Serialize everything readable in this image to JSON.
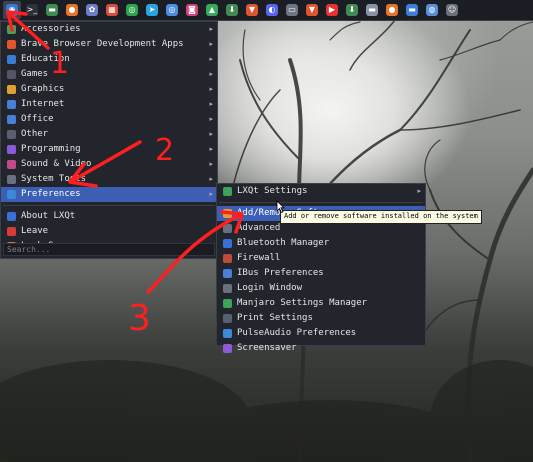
{
  "taskbar": {
    "icons": [
      {
        "name": "app-menu-icon",
        "color": "#3a78d8",
        "glyph": "◉"
      },
      {
        "name": "terminal-icon",
        "color": "#2e3138",
        "glyph": ">_"
      },
      {
        "name": "files-icon",
        "color": "#3f8b52",
        "glyph": "▬"
      },
      {
        "name": "firefox-icon",
        "color": "#e8742a",
        "glyph": "●"
      },
      {
        "name": "settings-icon",
        "color": "#6b7cc8",
        "glyph": "✿"
      },
      {
        "name": "grid-icon",
        "color": "#d94b3d",
        "glyph": "▦"
      },
      {
        "name": "chrome-icon",
        "color": "#2fa24f",
        "glyph": "◎"
      },
      {
        "name": "telegram-icon",
        "color": "#2aa3de",
        "glyph": "➤"
      },
      {
        "name": "chromium-icon",
        "color": "#4a8de0",
        "glyph": "◎"
      },
      {
        "name": "instagram-icon",
        "color": "#d7427c",
        "glyph": "◙"
      },
      {
        "name": "android-icon",
        "color": "#38a85a",
        "glyph": "▲"
      },
      {
        "name": "download-icon",
        "color": "#3f8b52",
        "glyph": "⬇"
      },
      {
        "name": "brave-icon",
        "color": "#e2542c",
        "glyph": "▼"
      },
      {
        "name": "discord-icon",
        "color": "#5865f2",
        "glyph": "◐"
      },
      {
        "name": "window-icon",
        "color": "#6e7684",
        "glyph": "▭"
      },
      {
        "name": "brave-icon-2",
        "color": "#e2542c",
        "glyph": "▼"
      },
      {
        "name": "youtube-icon",
        "color": "#e63434",
        "glyph": "▶"
      },
      {
        "name": "download-icon-2",
        "color": "#3f8b52",
        "glyph": "⬇"
      },
      {
        "name": "screen-icon",
        "color": "#8a93a6",
        "glyph": "▬"
      },
      {
        "name": "firefox-icon-2",
        "color": "#e8742a",
        "glyph": "●"
      },
      {
        "name": "desktop-icon",
        "color": "#3d7ed6",
        "glyph": "▬"
      },
      {
        "name": "web-icon",
        "color": "#5a8fd8",
        "glyph": "◍"
      },
      {
        "name": "face-icon",
        "color": "#6a6f7a",
        "glyph": "☺"
      }
    ]
  },
  "main_menu": {
    "items": [
      {
        "label": "Accessories",
        "icon": "accessories-icon",
        "color": "#4aa05a",
        "submenu": true
      },
      {
        "label": "Brave Browser Development Apps",
        "icon": "brave-apps-icon",
        "color": "#e2542c",
        "submenu": true
      },
      {
        "label": "Education",
        "icon": "education-icon",
        "color": "#3a7bd5",
        "submenu": true
      },
      {
        "label": "Games",
        "icon": "games-icon",
        "color": "#556",
        "submenu": true
      },
      {
        "label": "Graphics",
        "icon": "graphics-icon",
        "color": "#e0a030",
        "submenu": true
      },
      {
        "label": "Internet",
        "icon": "internet-icon",
        "color": "#4a7fd8",
        "submenu": true
      },
      {
        "label": "Office",
        "icon": "office-icon",
        "color": "#4a7fd8",
        "submenu": true
      },
      {
        "label": "Other",
        "icon": "other-icon",
        "color": "#5a6070",
        "submenu": true
      },
      {
        "label": "Programming",
        "icon": "programming-icon",
        "color": "#8a5ad8",
        "submenu": true
      },
      {
        "label": "Sound & Video",
        "icon": "sound-video-icon",
        "color": "#c04a8a",
        "submenu": true
      },
      {
        "label": "System Tools",
        "icon": "system-tools-icon",
        "color": "#6a7080",
        "submenu": true
      },
      {
        "label": "Preferences",
        "icon": "preferences-icon",
        "color": "#3a8ad8",
        "submenu": true,
        "highlight": true
      },
      {
        "label": "About LXQt",
        "icon": "about-icon",
        "color": "#3a6fd8",
        "submenu": false
      },
      {
        "label": "Leave",
        "icon": "leave-icon",
        "color": "#d83a3a",
        "submenu": false
      },
      {
        "label": "Lock Screen",
        "icon": "lock-icon",
        "color": "#d8703a",
        "submenu": false
      }
    ],
    "search_placeholder": "Search..."
  },
  "submenu": {
    "items": [
      {
        "label": "LXQt Settings",
        "icon": "lxqt-settings-icon",
        "color": "#3aa55a",
        "submenu": true
      },
      {
        "label": "Add/Remove Software",
        "icon": "add-remove-software-icon",
        "color": "#e0a030",
        "submenu": false,
        "highlight": true
      },
      {
        "label": "Advanced",
        "icon": "advanced-icon",
        "color": "#6a7080",
        "submenu": false
      },
      {
        "label": "Bluetooth Manager",
        "icon": "bluetooth-icon",
        "color": "#3a6fd8",
        "submenu": false
      },
      {
        "label": "Firewall",
        "icon": "firewall-icon",
        "color": "#c04a3a",
        "submenu": false
      },
      {
        "label": "IBus Preferences",
        "icon": "ibus-icon",
        "color": "#4a7fd8",
        "submenu": false
      },
      {
        "label": "Login Window",
        "icon": "login-window-icon",
        "color": "#6a7080",
        "submenu": false
      },
      {
        "label": "Manjaro Settings Manager",
        "icon": "manjaro-settings-icon",
        "color": "#3aa55a",
        "submenu": false
      },
      {
        "label": "Print Settings",
        "icon": "print-icon",
        "color": "#5a6070",
        "submenu": false
      },
      {
        "label": "PulseAudio Preferences",
        "icon": "pulseaudio-icon",
        "color": "#3a8ad8",
        "submenu": false
      },
      {
        "label": "Screensaver",
        "icon": "screensaver-icon",
        "color": "#8a5ad8",
        "submenu": false
      }
    ]
  },
  "tooltip": {
    "text": "Add or remove software installed on the system"
  },
  "annotations": {
    "num1": "1",
    "num2": "2",
    "num3": "3",
    "color": "#ff1f1f"
  }
}
